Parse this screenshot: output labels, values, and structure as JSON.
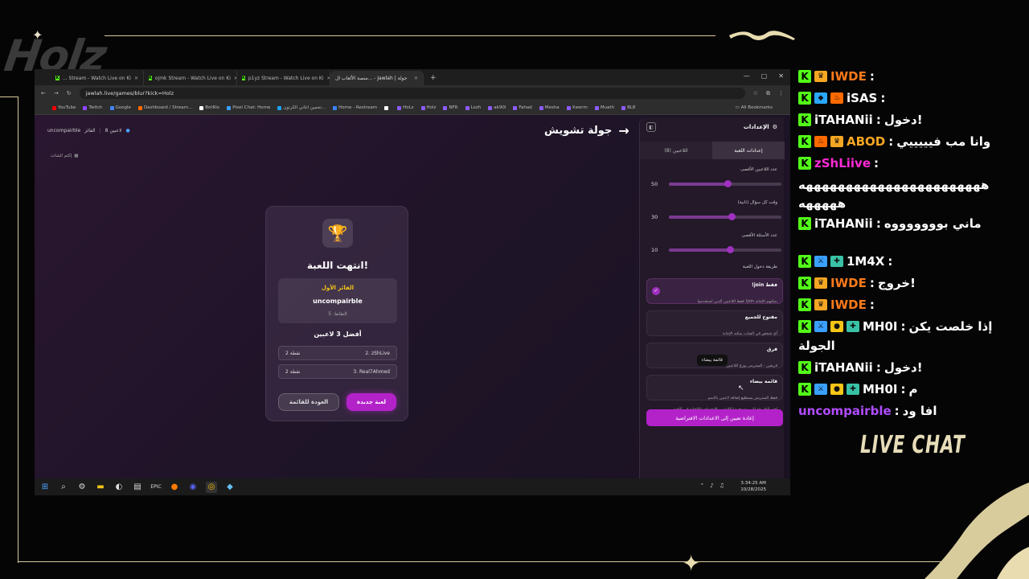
{
  "overlay": {
    "logo_text": "Holz",
    "live_chat_label": "LIVE CHAT"
  },
  "browser": {
    "tabs": [
      {
        "label": "... Stream - Watch Live on Ki",
        "active": false
      },
      {
        "label": "ojmk Stream - Watch Live on Ki",
        "active": false
      },
      {
        "label": "p1yz Stream - Watch Live on Ki",
        "active": false
      },
      {
        "label": "منصة الألعاب ال... - Jawlah | جولة",
        "active": true
      }
    ],
    "url": "jawlah.live/games/blur?kick=Holz",
    "bookmarks": [
      "YouTube",
      "Twitch",
      "Google",
      "Dashboard / Stream...",
      "BotRix",
      "Pixel Chat: Home",
      "تخمين اغاني الكرتون...",
      "Home - Restream",
      "",
      "HoLz",
      "Holz",
      "NFR",
      "Lozh",
      "ak90l",
      "Fahad",
      "Mesha",
      "Xwerm",
      "Muath",
      "BL8"
    ],
    "all_bookmarks": "All Bookmarks",
    "bookmark_colors": [
      "#ff0000",
      "#9146ff",
      "#4285f4",
      "#ff6a00",
      "#ffffff",
      "#3aa0ff",
      "#1da1f2",
      "#3b82f6",
      "#ffffff",
      "#8b5cf6",
      "#8b5cf6",
      "#8b5cf6",
      "#8b5cf6",
      "#8b5cf6",
      "#8b5cf6",
      "#8b5cf6",
      "#8b5cf6",
      "#8b5cf6",
      "#8b5cf6"
    ]
  },
  "game": {
    "winner_top_name": "uncompairble",
    "winner_top_label": "الفائز",
    "players_count_label": "8 لاعبين",
    "mute_chat": "إكتم الشات",
    "round_title": "جولة تشويش",
    "game_over": "انتهت اللعبة!",
    "first_place_label": "الفائز الأول",
    "winner_name": "uncompairble",
    "winner_points": "النقاط: 5",
    "top3_label": "أفضل 3 لاعبين",
    "ranks": [
      {
        "name": "2. zShLive",
        "points": "2 نقطة"
      },
      {
        "name": "3. Real7Ahmed",
        "points": "2 نقطة"
      }
    ],
    "back_button": "العودة للقائمة",
    "new_game_button": "لعبة جديدة"
  },
  "settings": {
    "title": "الإعدادات",
    "tab_players": "اللاعبين (8)",
    "tab_game": "إعدادات اللعبة",
    "sliders": [
      {
        "label": "عدد اللاعبين الأقصى",
        "value": "50",
        "fraction": 0.52
      },
      {
        "label": "وقت كل سؤال (ثانية)",
        "value": "30",
        "fraction": 0.56
      },
      {
        "label": "عدد الأسئلة الأقصى",
        "value": "10",
        "fraction": 0.54
      }
    ],
    "method_label": "طريقة دخول اللعبة",
    "options": [
      {
        "title": "!join فقط",
        "desc": "فقط اللاعبين الذين استخدموا !join يمكنهم الإجابة",
        "selected": true
      },
      {
        "title": "مفتوح للجميع",
        "desc": "أي شخص في الشات يمكنه الإجابة",
        "selected": false
      },
      {
        "title": "فرق",
        "desc": "فريقين - الستريمر يوزع اللاعبين",
        "selected": false
      },
      {
        "title": "قائمة بيضاء",
        "desc": "فقط الستريمر يستطيع إضافة لاعبين بالاسم",
        "selected": false
      }
    ],
    "tooltip": "قائمة بيضاء",
    "method_help": "اختر الطريقة التي يسمح بها اللاعبين بالانضمام واللإجابة في اللعبة",
    "reset_button": "إعادة تعيين إلى الاعدادات الافتراضية"
  },
  "taskbar": {
    "time": "3:34:25 AM",
    "date": "10/28/2025"
  },
  "chat": {
    "messages": [
      {
        "badges": [
          "crown"
        ],
        "user": "IWDE",
        "color": "#ff7a1a",
        "text": ""
      },
      {
        "badges": [
          "gem",
          "fire"
        ],
        "user": "iSAS",
        "color": "#ffffff",
        "text": ""
      },
      {
        "badges": [],
        "user": "iTAHANii",
        "color": "#ffffff",
        "text": "دخول!"
      },
      {
        "badges": [
          "fire",
          "crown"
        ],
        "user": "ABOD",
        "color": "#f5a623",
        "text": "وانا مب فيييييي"
      },
      {
        "badges": [],
        "user": "zShLiive",
        "color": "#ff2bd6",
        "text": ""
      },
      {
        "badges": [],
        "user": "",
        "color": "#ffffff",
        "text": "هههههههههههههههههههههههه"
      },
      {
        "badges": [],
        "user": "",
        "color": "#ffffff",
        "text": "هههههه"
      },
      {
        "badges": [],
        "user": "iTAHANii",
        "color": "#ffffff",
        "text": "ماني بوووووووه"
      },
      {
        "badges": [
          "sword",
          "gift"
        ],
        "user": "1M4X",
        "color": "#ffffff",
        "text": ""
      },
      {
        "badges": [
          "crown"
        ],
        "user": "IWDE",
        "color": "#ff7a1a",
        "text": "خروج!"
      },
      {
        "badges": [
          "crown"
        ],
        "user": "IWDE",
        "color": "#ff7a1a",
        "text": ""
      },
      {
        "badges": [
          "sword",
          "coin",
          "gift"
        ],
        "user": "MH0I",
        "color": "#ffffff",
        "text": "إذا خلصت يكن"
      },
      {
        "badges": [],
        "user": "",
        "color": "#ffffff",
        "text": "الجولة"
      },
      {
        "badges": [],
        "user": "iTAHANii",
        "color": "#ffffff",
        "text": "دخول!"
      },
      {
        "badges": [
          "sword",
          "coin",
          "gift"
        ],
        "user": "MH0I",
        "color": "#ffffff",
        "text": "م"
      },
      {
        "badges": [],
        "user": "uncompairble",
        "color": "#b14cff",
        "text": "افا ود"
      }
    ]
  }
}
